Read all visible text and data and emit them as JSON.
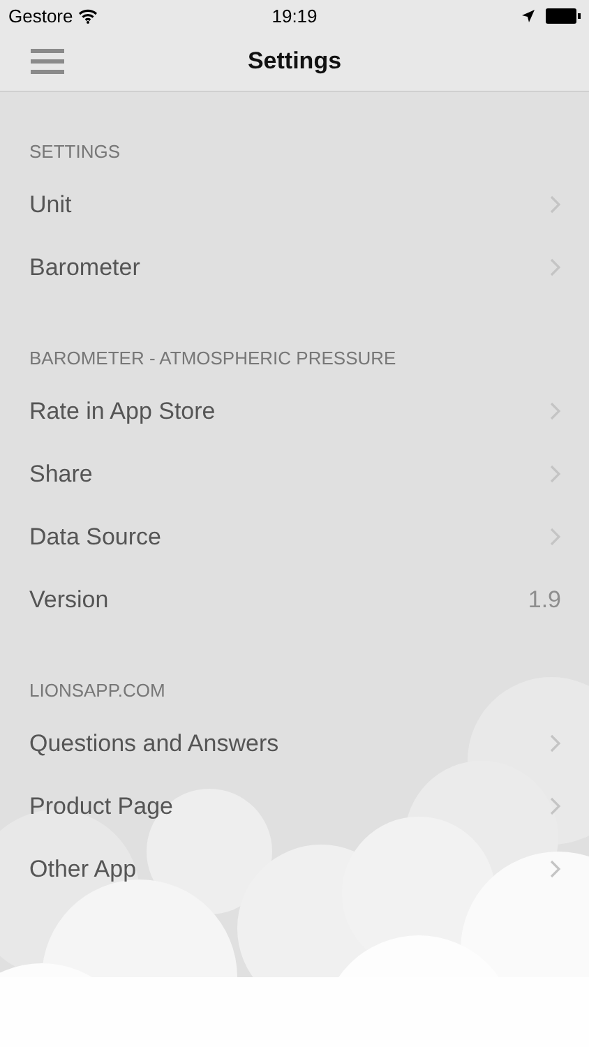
{
  "status_bar": {
    "carrier": "Gestore",
    "time": "19:19"
  },
  "nav_bar": {
    "title": "Settings"
  },
  "sections": [
    {
      "header": "SETTINGS",
      "rows": [
        {
          "kind": "link",
          "label": "Unit"
        },
        {
          "kind": "link",
          "label": "Barometer"
        }
      ]
    },
    {
      "header": "BAROMETER - ATMOSPHERIC PRESSURE",
      "rows": [
        {
          "kind": "link",
          "label": "Rate in App Store"
        },
        {
          "kind": "link",
          "label": "Share"
        },
        {
          "kind": "link",
          "label": "Data Source"
        },
        {
          "kind": "value",
          "label": "Version",
          "value": "1.9"
        }
      ]
    },
    {
      "header": "LIONSAPP.COM",
      "rows": [
        {
          "kind": "link",
          "label": "Questions and Answers"
        },
        {
          "kind": "link",
          "label": "Product Page"
        },
        {
          "kind": "link",
          "label": "Other App"
        }
      ]
    }
  ]
}
